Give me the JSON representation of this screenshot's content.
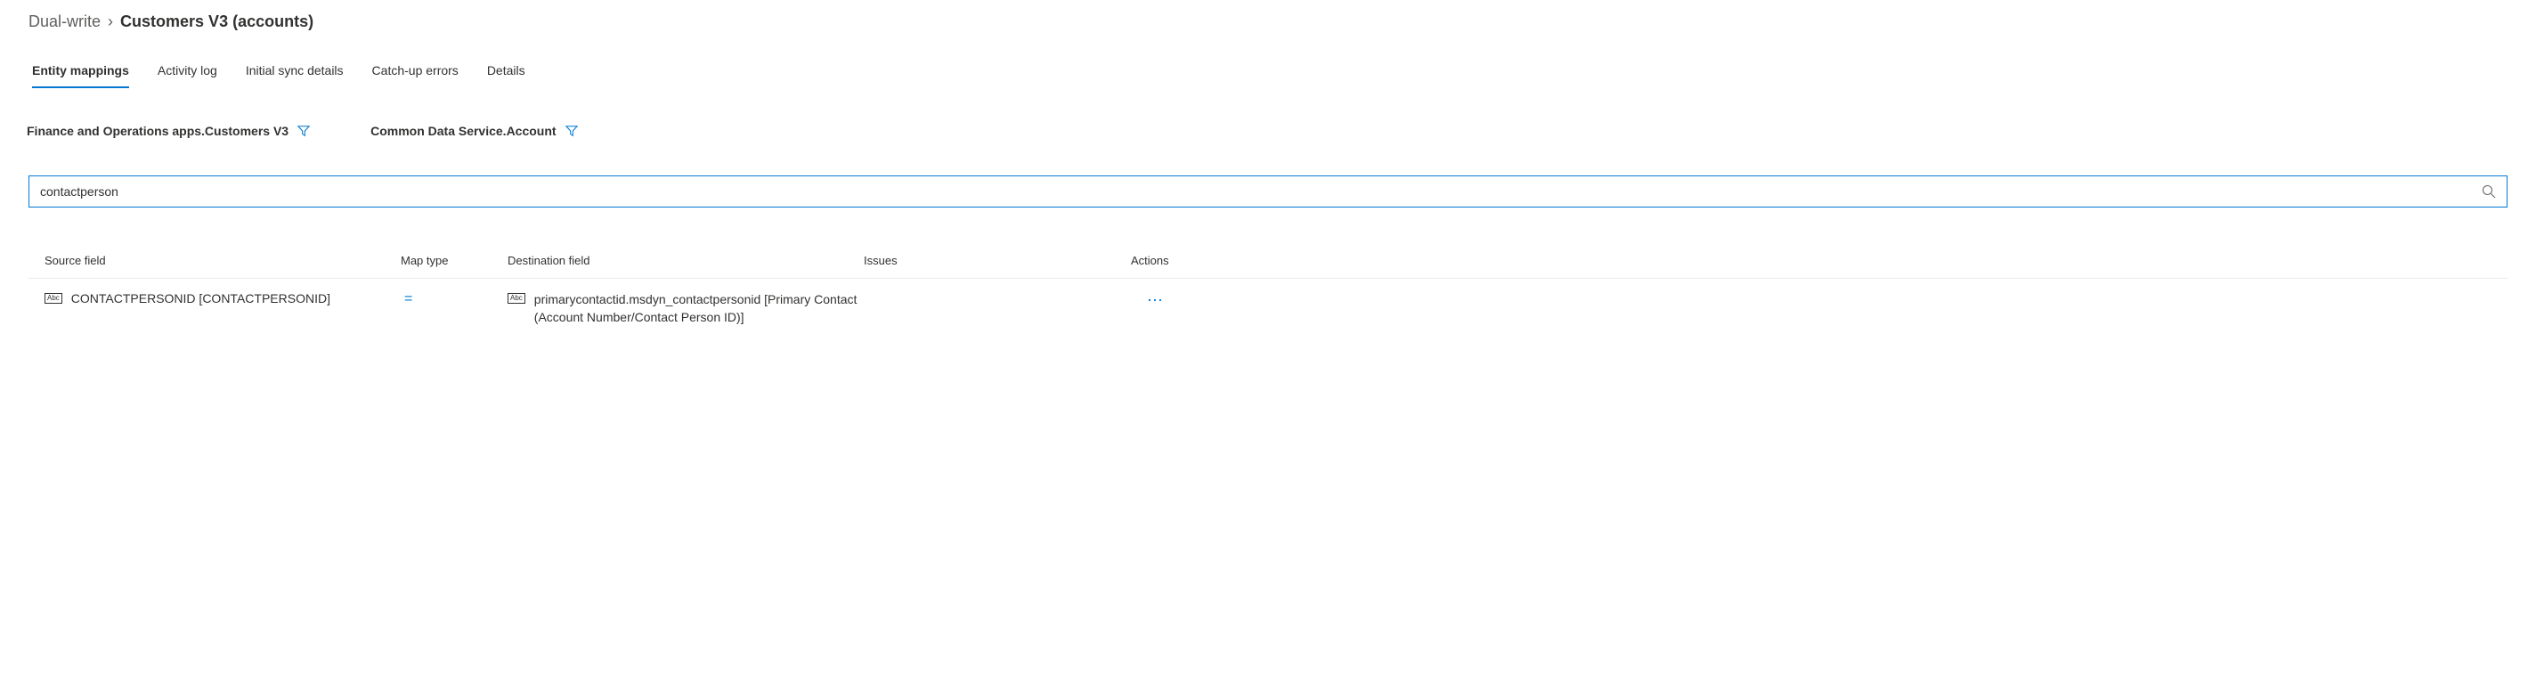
{
  "breadcrumb": {
    "parent": "Dual-write",
    "current": "Customers V3 (accounts)"
  },
  "tabs": [
    {
      "label": "Entity mappings",
      "active": true
    },
    {
      "label": "Activity log",
      "active": false
    },
    {
      "label": "Initial sync details",
      "active": false
    },
    {
      "label": "Catch-up errors",
      "active": false
    },
    {
      "label": "Details",
      "active": false
    }
  ],
  "filters": {
    "left": "Finance and Operations apps.Customers V3",
    "right": "Common Data Service.Account"
  },
  "search": {
    "value": "contactperson",
    "placeholder": ""
  },
  "table": {
    "columns": {
      "source": "Source field",
      "maptype": "Map type",
      "dest": "Destination field",
      "issues": "Issues",
      "actions": "Actions"
    },
    "rows": [
      {
        "source_type_icon": "Abc",
        "source": "CONTACTPERSONID [CONTACTPERSONID]",
        "maptype": "=",
        "dest_type_icon": "Abc",
        "dest": "primarycontactid.msdyn_contactpersonid [Primary Contact (Account Number/Contact Person ID)]",
        "issues": "",
        "actions": "⋯"
      }
    ]
  }
}
